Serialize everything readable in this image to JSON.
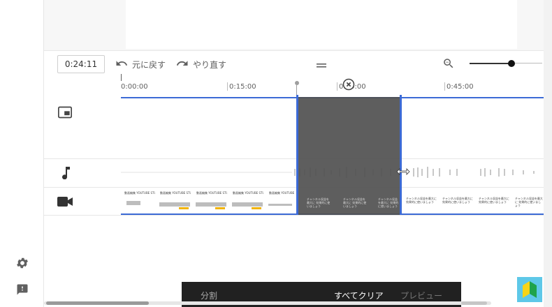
{
  "toolbar": {
    "timecode": "0:24:11",
    "undo_label": "元に戻す",
    "redo_label": "やり直す"
  },
  "ruler": {
    "ticks": [
      "0:00:00",
      "0:15:00",
      "0:30:00",
      "0:45:00"
    ]
  },
  "clips": {
    "thumb_text_a": "動画編集 YOUTUBE STUDIO",
    "thumb_text_b": "チャンネル収益を最大に 効果的に使いましょう"
  },
  "bottom_bar": {
    "split_label": "分割",
    "clear_all_label": "すべてクリア",
    "preview_label": "プレビュー"
  },
  "colors": {
    "accent_blue": "#3b6ad6",
    "selection_gray": "#5f5f5f",
    "bottom_bar_bg": "#212121"
  },
  "icons": {
    "undo": "undo-icon",
    "redo": "redo-icon",
    "zoom_out": "zoom-out-icon",
    "drag_handle": "drag-handle-icon",
    "remove": "remove-circle-icon",
    "overlay_track": "picture-in-picture-icon",
    "audio_track": "music-note-icon",
    "video_track": "videocam-icon",
    "settings": "gear-icon",
    "feedback": "feedback-icon",
    "beginner_mark": "beginner-mark-icon"
  }
}
